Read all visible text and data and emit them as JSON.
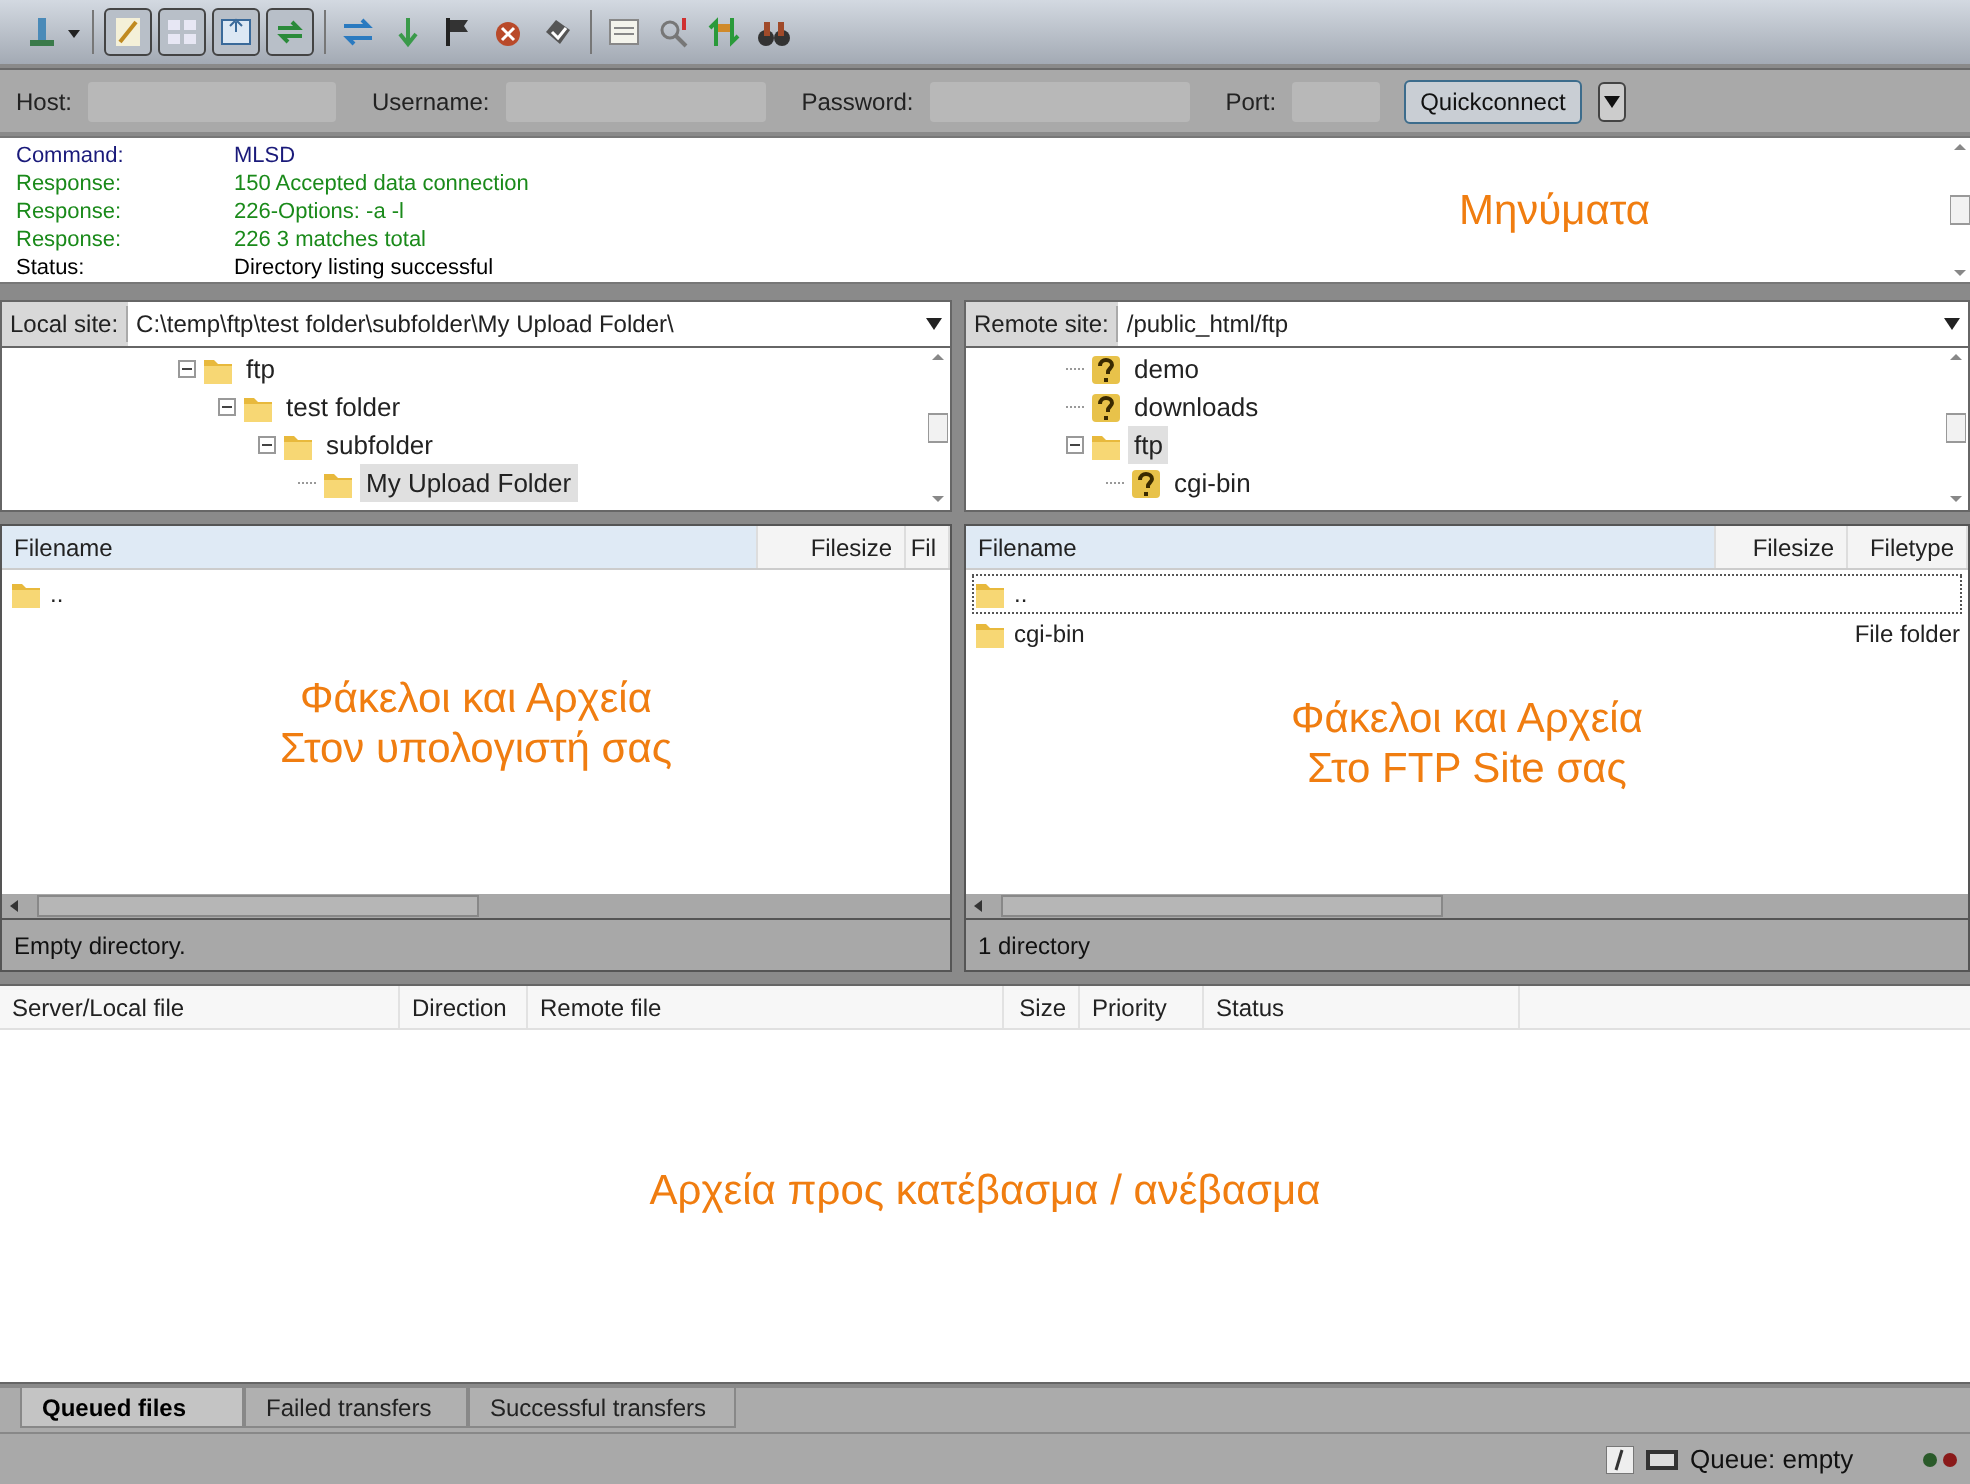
{
  "toolbar_toggles": [
    {
      "on": true
    },
    {
      "on": true
    },
    {
      "on": true
    },
    {
      "on": true
    }
  ],
  "quickconnect": {
    "fields": [
      {
        "label": "Host:"
      },
      {
        "label": "Username:"
      },
      {
        "label": "Password:"
      },
      {
        "label": "Port:"
      }
    ],
    "button": "Quickconnect"
  },
  "message_log": {
    "lines": [
      {
        "kind": "command",
        "label": "Command:",
        "text": "MLSD"
      },
      {
        "kind": "response",
        "label": "Response:",
        "text": "150 Accepted data connection"
      },
      {
        "kind": "response",
        "label": "Response:",
        "text": "226-Options: -a -l"
      },
      {
        "kind": "response",
        "label": "Response:",
        "text": "226 3 matches total"
      },
      {
        "kind": "status",
        "label": "Status:",
        "text": "Directory listing successful"
      }
    ],
    "annotation": [
      "Μηνύματα"
    ]
  },
  "local": {
    "site_label": "Local site:",
    "path": "C:\\temp\\ftp\\test folder\\subfolder\\My Upload Folder\\",
    "tree": [
      {
        "name": "ftp",
        "kind": "folder",
        "expanded": true,
        "selected": false,
        "children": [
          {
            "name": "test folder",
            "kind": "folder",
            "expanded": true,
            "selected": false,
            "children": [
              {
                "name": "subfolder",
                "kind": "folder",
                "expanded": true,
                "selected": false,
                "children": [
                  {
                    "name": "My Upload Folder",
                    "kind": "folder",
                    "selected": true
                  }
                ]
              }
            ]
          }
        ]
      }
    ],
    "columns": [
      "Filename",
      "Filesize",
      "Fil"
    ],
    "rows": [
      {
        "name": "..",
        "type": "",
        "focused": false
      }
    ],
    "annotation": [
      "Φάκελοι και Αρχεία",
      "Στον υπολογιστή σας"
    ],
    "status": "Empty directory."
  },
  "remote": {
    "site_label": "Remote site:",
    "path": "/public_html/ftp",
    "tree": [
      {
        "name": "demo",
        "kind": "unknown",
        "selected": false
      },
      {
        "name": "downloads",
        "kind": "unknown",
        "selected": false
      },
      {
        "name": "ftp",
        "kind": "folder",
        "expanded": true,
        "selected": true,
        "children": [
          {
            "name": "cgi-bin",
            "kind": "unknown",
            "selected": false
          }
        ]
      }
    ],
    "columns": [
      "Filename",
      "Filesize",
      "Filetype"
    ],
    "rows": [
      {
        "name": "..",
        "type": "",
        "focused": true
      },
      {
        "name": "cgi-bin",
        "type": "File folder",
        "focused": false
      }
    ],
    "annotation": [
      "Φάκελοι και Αρχεία",
      "Στο FTP Site σας"
    ],
    "status": "1 directory"
  },
  "queue": {
    "columns": [
      "Server/Local file",
      "Direction",
      "Remote file",
      "Size",
      "Priority",
      "Status"
    ],
    "annotation": [
      "Αρχεία προς κατέβασμα / ανέβασμα"
    ]
  },
  "tabs": [
    {
      "label": "Queued files",
      "selected": true
    },
    {
      "label": "Failed transfers",
      "selected": false
    },
    {
      "label": "Successful transfers",
      "selected": false
    }
  ],
  "status_bar": {
    "queue": "Queue: empty"
  }
}
